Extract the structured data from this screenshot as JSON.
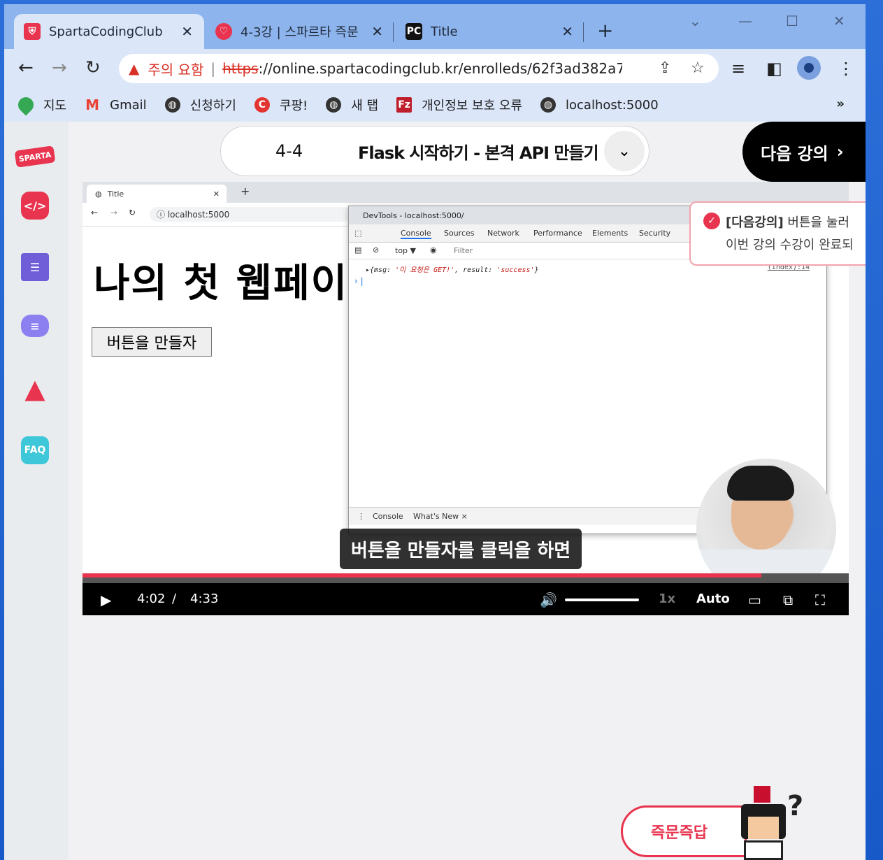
{
  "browser": {
    "tabs": [
      {
        "label": "SpartaCodingClub",
        "icon": "sparta-shield-icon"
      },
      {
        "label": "4-3강 | 스파르타 즉문",
        "icon": "sparta-chat-icon"
      },
      {
        "label": "Title",
        "icon": "pycharm-icon"
      }
    ],
    "address": {
      "warning_text": "주의 요함",
      "scheme": "https",
      "url_rest": "://online.spartacodingclub.kr/enrolleds/62f3ad382a735..."
    },
    "bookmarks": [
      {
        "label": "지도",
        "icon": "maps-pin-icon"
      },
      {
        "label": "Gmail",
        "icon": "gmail-icon"
      },
      {
        "label": "신청하기",
        "icon": "globe-icon"
      },
      {
        "label": "쿠팡!",
        "icon": "coupang-icon"
      },
      {
        "label": "새 탭",
        "icon": "globe-icon"
      },
      {
        "label": "개인정보 보호 오류",
        "icon": "filezilla-icon"
      },
      {
        "label": "localhost:5000",
        "icon": "globe-icon"
      }
    ],
    "bookmarks_more": "»"
  },
  "lecture": {
    "number": "4-4",
    "title": "Flask 시작하기 - 본격 API 만들기 (",
    "next_label": "다음 강의"
  },
  "sidebar": {
    "logo_text": "SPARTA",
    "faq_label": "FAQ"
  },
  "video": {
    "inner_tab_title": "Title",
    "inner_url": "localhost:5000",
    "page_heading": "나의 첫 웹페이",
    "page_button": "버튼을 만들자",
    "devtools": {
      "title": "DevTools - localhost:5000/",
      "tabs": [
        "Console",
        "Sources",
        "Network",
        "Performance",
        "Elements",
        "Security"
      ],
      "context": "top ▼",
      "filter_placeholder": "Filter",
      "log_prefix": "▸{msg: ",
      "log_msg": "'이 요청은 GET!'",
      "log_mid": ", result: ",
      "log_result": "'success'",
      "log_suffix": "}",
      "log_source": "(index):14",
      "drawer_tabs": [
        "Console",
        "What's New ×"
      ]
    },
    "caption": "버튼을 만들자를 클릭을 하면",
    "progress": 0.886,
    "current_time": "4:02",
    "time_sep": "/",
    "duration": "4:33",
    "speed": "1x",
    "quality": "Auto"
  },
  "toast": {
    "bold": "[다음강의]",
    "line1_rest": " 버튼을 눌러",
    "line2": "이번 강의 수강이 완료되"
  },
  "chatbot": {
    "label": "즉문즉답"
  },
  "colors": {
    "brand": "#e8344e",
    "tabstrip": "#8eb4ed",
    "toolbar": "#dbe6f8"
  }
}
